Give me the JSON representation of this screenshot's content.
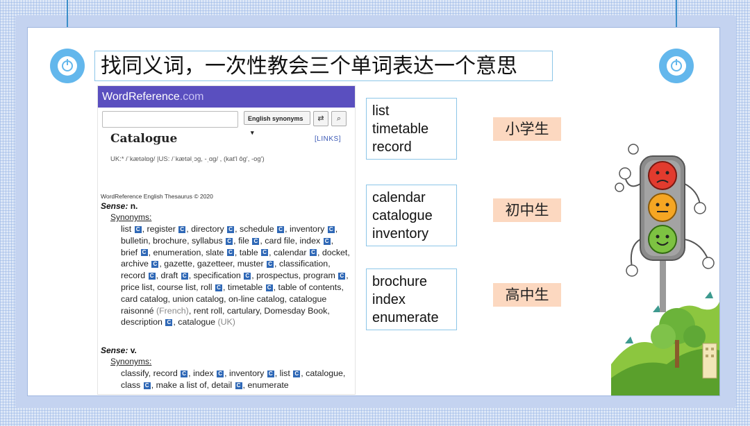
{
  "title": "找同义词，一次性教会三个单词表达一个意思",
  "dictionary": {
    "site_name": "WordReference",
    "site_domain": ".com",
    "search_placeholder": "",
    "select_value": "English synonyms",
    "select_arrow": "▾",
    "swap_icon": "⇄",
    "search_icon": "⌕",
    "headword": "Catalogue",
    "links_label": "[LINKS]",
    "pronunciation": "UK:* /ˈkætəlɒɡ/  |US: /ˈkætəlˌɔɡ, -ˌɑɡ/ , (katʹl ôg′, -og′)",
    "thesaurus_credit": "WordReference English Thesaurus © 2020",
    "badge_letter": "C",
    "senses": [
      {
        "label": "Sense:",
        "pos": "n.",
        "synonyms_heading": "Synonyms:",
        "synonyms": [
          {
            "w": "list",
            "c": true
          },
          {
            "w": "register",
            "c": true
          },
          {
            "w": "directory",
            "c": true
          },
          {
            "w": "schedule",
            "c": true
          },
          {
            "w": "inventory",
            "c": true
          },
          {
            "w": "bulletin",
            "c": false
          },
          {
            "w": "brochure",
            "c": false
          },
          {
            "w": "syllabus",
            "c": true
          },
          {
            "w": "file",
            "c": true
          },
          {
            "w": "card file",
            "c": false
          },
          {
            "w": "index",
            "c": true
          },
          {
            "w": "brief",
            "c": true
          },
          {
            "w": "enumeration",
            "c": false
          },
          {
            "w": "slate",
            "c": true
          },
          {
            "w": "table",
            "c": true
          },
          {
            "w": "calendar",
            "c": true
          },
          {
            "w": "docket",
            "c": false
          },
          {
            "w": "archive",
            "c": true
          },
          {
            "w": "gazette",
            "c": false
          },
          {
            "w": "gazetteer",
            "c": false
          },
          {
            "w": "muster",
            "c": true
          },
          {
            "w": "classification",
            "c": false
          },
          {
            "w": "record",
            "c": true
          },
          {
            "w": "draft",
            "c": true
          },
          {
            "w": "specification",
            "c": true
          },
          {
            "w": "prospectus",
            "c": false
          },
          {
            "w": "program",
            "c": true
          },
          {
            "w": "price list",
            "c": false
          },
          {
            "w": "course list",
            "c": false
          },
          {
            "w": "roll",
            "c": true
          },
          {
            "w": "timetable",
            "c": true
          },
          {
            "w": "table of contents",
            "c": false
          },
          {
            "w": "card catalog",
            "c": false
          },
          {
            "w": "union catalog",
            "c": false
          },
          {
            "w": "on-line catalog",
            "c": false
          },
          {
            "w": "catalogue raisonné",
            "c": false,
            "note": "(French)"
          },
          {
            "w": "rent roll",
            "c": false
          },
          {
            "w": "cartulary",
            "c": false
          },
          {
            "w": "Domesday Book",
            "c": false
          },
          {
            "w": "description",
            "c": true
          },
          {
            "w": "catalogue",
            "c": false,
            "note": "(UK)"
          }
        ]
      },
      {
        "label": "Sense:",
        "pos": "v.",
        "synonyms_heading": "Synonyms:",
        "synonyms": [
          {
            "w": "classify",
            "c": false
          },
          {
            "w": "record",
            "c": true
          },
          {
            "w": "index",
            "c": true
          },
          {
            "w": "inventory",
            "c": true
          },
          {
            "w": "list",
            "c": true
          },
          {
            "w": "catalogue",
            "c": false
          },
          {
            "w": "class",
            "c": true
          },
          {
            "w": "make a list of",
            "c": false
          },
          {
            "w": "detail",
            "c": true
          },
          {
            "w": "enumerate",
            "c": false
          }
        ]
      }
    ]
  },
  "word_groups": [
    {
      "words": [
        "list",
        "timetable",
        "record"
      ],
      "level": "小学生"
    },
    {
      "words": [
        "calendar",
        "catalogue",
        "inventory"
      ],
      "level": "初中生"
    },
    {
      "words": [
        "brochure",
        "index",
        "enumerate"
      ],
      "level": "高中生"
    }
  ],
  "illustration": "traffic-light-with-faces-and-trees",
  "colors": {
    "accent_blue": "#63b7ec",
    "wr_purple": "#5a4fbf",
    "level_bg": "#fcd8c0",
    "box_border": "#8cc6e8"
  }
}
